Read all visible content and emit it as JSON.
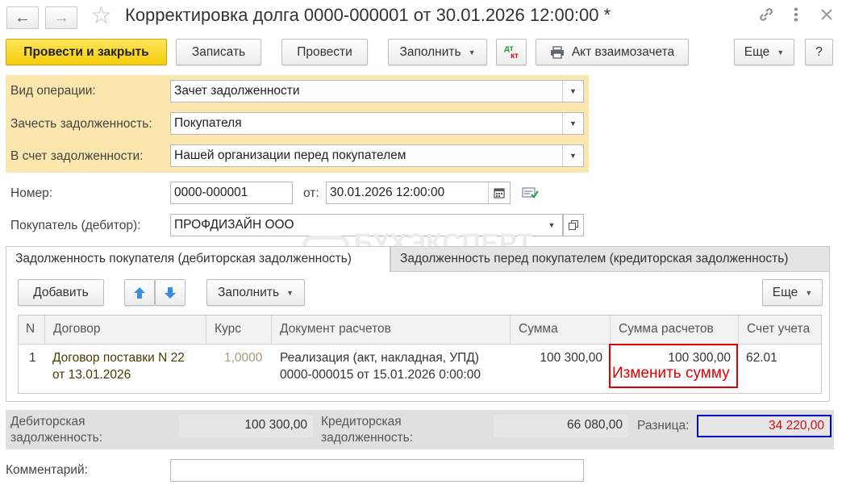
{
  "header": {
    "title": "Корректировка долга 0000-000001 от 30.01.2026 12:00:00 *",
    "back_icon": "arrow-left-icon",
    "forward_icon": "arrow-right-icon",
    "favorite_icon": "star-icon",
    "link_icon": "link-icon",
    "more_icon": "kebab-icon",
    "close_icon": "close-icon"
  },
  "toolbar": {
    "post_close_label": "Провести и закрыть",
    "save_label": "Записать",
    "post_label": "Провести",
    "fill_label": "Заполнить",
    "dtkt_top": "дт",
    "dtkt_bottom": "кт",
    "act_label": "Акт взаимозачета",
    "more_label": "Еще",
    "help_label": "?"
  },
  "operation": {
    "type_label": "Вид операции:",
    "type_value": "Зачет задолженности",
    "offset_label": "Зачесть задолженность:",
    "offset_value": "Покупателя",
    "against_label": "В счет задолженности:",
    "against_value": "Нашей организации перед покупателем"
  },
  "doc": {
    "number_label": "Номер:",
    "number_value": "0000-000001",
    "date_label": "от:",
    "date_value": "30.01.2026 12:00:00",
    "buyer_label": "Покупатель (дебитор):",
    "buyer_value": "ПРОФДИЗАЙН ООО"
  },
  "watermark": "БУХЭКСПЕРТ",
  "tabs": [
    {
      "label": "Задолженность покупателя (дебиторская задолженность)"
    },
    {
      "label": "Задолженность перед покупателем (кредиторская задолженность)"
    }
  ],
  "table_toolbar": {
    "add_label": "Добавить",
    "fill_label": "Заполнить",
    "more_label": "Еще"
  },
  "table": {
    "columns": [
      "N",
      "Договор",
      "Курс",
      "Документ расчетов",
      "Сумма",
      "Сумма расчетов",
      "Счет учета"
    ],
    "rows": [
      {
        "n": "1",
        "contract_line1": "Договор поставки N 22",
        "contract_line2": "от 13.01.2026",
        "rate": "1,0000",
        "doc_line1": "Реализация (акт, накладная, УПД)",
        "doc_line2": "0000-000015 от 15.01.2026 0:00:00",
        "amount": "100 300,00",
        "settlement_amount": "100 300,00",
        "account": "62.01"
      }
    ],
    "annotation": "Изменить сумму"
  },
  "totals": {
    "receivable_label_1": "Дебиторская",
    "receivable_label_2": "задолженность:",
    "receivable_value": "100 300,00",
    "payable_label_1": "Кредиторская",
    "payable_label_2": "задолженность:",
    "payable_value": "66 080,00",
    "diff_label": "Разница:",
    "diff_value": "34 220,00"
  },
  "comment": {
    "label": "Комментарий:",
    "value": ""
  },
  "colors": {
    "primary_button": "#f5cd0a",
    "panel_bg": "#fbe6ae",
    "annotation_red": "#e00000",
    "highlight_blue": "#0000c8"
  }
}
